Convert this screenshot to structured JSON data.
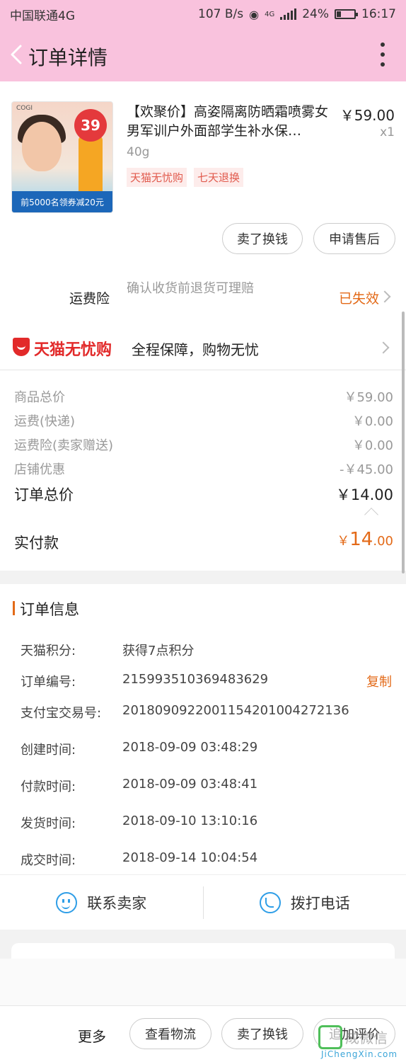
{
  "status_bar": {
    "carrier": "中国联通4G",
    "speed": "107 B/s",
    "network_badge": "4G",
    "battery": "24%",
    "battery_level": 0.24,
    "time": "16:17"
  },
  "nav": {
    "title": "订单详情"
  },
  "product": {
    "title": "【欢聚价】高姿隔离防晒霜喷雾女男军训户外面部学生补水保…",
    "spec": "40g",
    "price": "￥59.00",
    "qty": "x1",
    "badges": [
      "天猫无忧购",
      "七天退换"
    ],
    "image": {
      "brand": "COGI",
      "price_tag": "39",
      "banner": "前5000名领券减20元"
    },
    "actions": {
      "sell": "卖了换钱",
      "after_sale": "申请售后"
    }
  },
  "insurance": {
    "label": "运费险",
    "desc": "确认收货前退货可理赔",
    "status": "已失效"
  },
  "guarantee": {
    "brand": "天猫无忧购",
    "text": "全程保障，购物无忧"
  },
  "summary": {
    "rows": [
      {
        "label": "商品总价",
        "value": "￥59.00"
      },
      {
        "label": "运费(快递)",
        "value": "￥0.00"
      },
      {
        "label": "运费险(卖家赠送)",
        "value": "￥0.00"
      },
      {
        "label": "店铺优惠",
        "value": "-￥45.00"
      }
    ],
    "total_label": "订单总价",
    "total_value": "￥14.00",
    "paid_label": "实付款",
    "paid_currency": "￥",
    "paid_int": "14",
    "paid_dec": ".00"
  },
  "order_info": {
    "title": "订单信息",
    "copy": "复制",
    "rows": [
      {
        "label": "天猫积分:",
        "value": "获得7点积分"
      },
      {
        "label": "订单编号:",
        "value": "215993510369483629"
      },
      {
        "label": "支付宝交易号:",
        "value": "2018090922001154201004272136"
      },
      {
        "label": "创建时间:",
        "value": "2018-09-09 03:48:29"
      },
      {
        "label": "付款时间:",
        "value": "2018-09-09 03:48:41"
      },
      {
        "label": "发货时间:",
        "value": "2018-09-10 13:10:16"
      },
      {
        "label": "成交时间:",
        "value": "2018-09-14 10:04:54"
      }
    ],
    "contact_seller": "联系卖家",
    "call_phone": "拨打电话"
  },
  "bottom": {
    "more": "更多",
    "logistics": "查看物流",
    "sell": "卖了换钱",
    "review": "追加评价"
  },
  "watermark": {
    "text": "成微信",
    "url": "JiChengXin.com"
  },
  "colors": {
    "header_bg": "#f9c2dd",
    "accent_orange": "#e36a18",
    "tmall_red": "#e22a2a",
    "link_blue": "#2f9ee7"
  }
}
